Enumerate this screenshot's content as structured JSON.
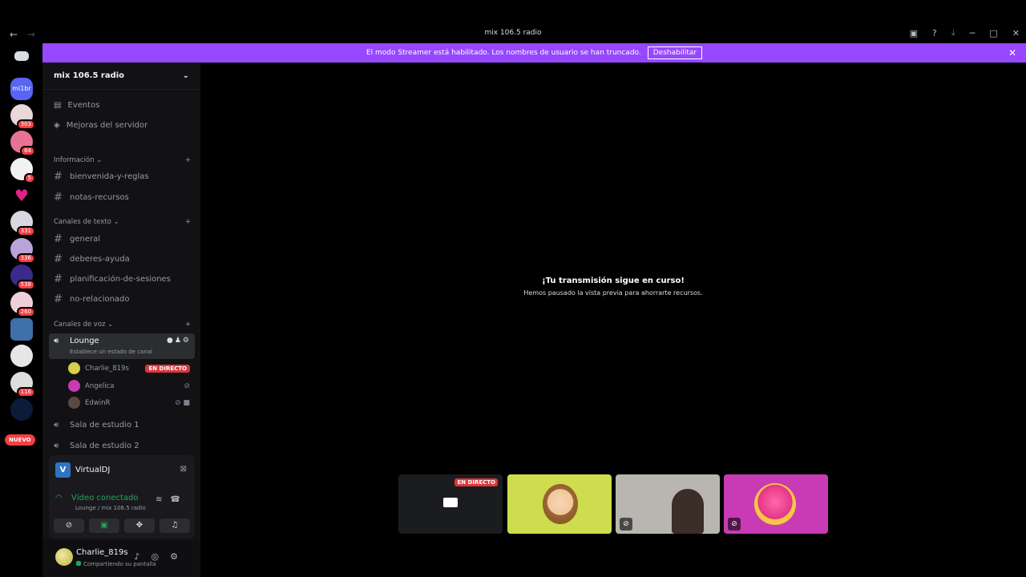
{
  "window": {
    "title": "mix 106.5 radio",
    "back": "←",
    "forward": "→"
  },
  "banner": {
    "text": "El modo Streamer está habilitado. Los nombres de usuario se han truncado.",
    "button": "Deshabilitar",
    "close": "✕"
  },
  "guilds": {
    "badges": [
      "303",
      "64",
      "5",
      "331",
      "336",
      "538",
      "260",
      "116"
    ],
    "new_label": "NUEVO",
    "server_label": "mi1br"
  },
  "server": {
    "name": "mix 106.5 radio",
    "events": "Eventos",
    "boosts": "Mejoras del servidor",
    "categories": {
      "info": "Información",
      "text": "Canales de texto",
      "voice": "Canales de voz"
    },
    "info_channels": [
      "bienvenida-y-reglas",
      "notas-recursos"
    ],
    "text_channels": [
      "general",
      "deberes-ayuda",
      "planificación-de-sesiones",
      "no-relacionado"
    ],
    "voice_active": {
      "name": "Lounge",
      "status": "Establece un estado de canal",
      "members": [
        {
          "name": "Charlie_819s",
          "badge": "EN DIRECTO"
        },
        {
          "name": "Angelica"
        },
        {
          "name": "EdwinR"
        }
      ]
    },
    "voice_channels": [
      "Sala de estudio 1",
      "Sala de estudio 2"
    ]
  },
  "panel": {
    "app_name": "VirtualDJ",
    "app_logo": "V",
    "connection": "Vídeo conectado",
    "connection_sub": "Lounge / mix 106.5 radio"
  },
  "user": {
    "name": "Charlie_819s",
    "status": "Compartiendo su pantalla"
  },
  "main": {
    "title": "¡Tu transmisión sigue en curso!",
    "subtitle": "Hemos pausado la vista previa para ahorrarte recursos.",
    "live_label": "EN DIRECTO"
  },
  "colors": {
    "banner": "#9747ff",
    "live": "#da373c",
    "green": "#23a55a"
  }
}
